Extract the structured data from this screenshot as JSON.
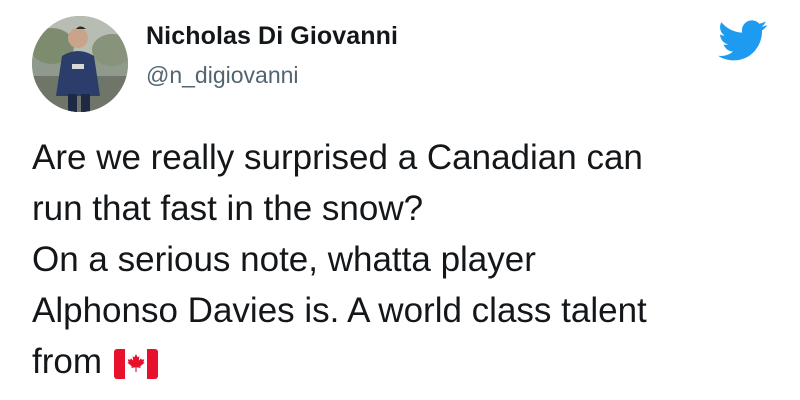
{
  "tweet": {
    "author_name": "Nicholas Di Giovanni",
    "author_handle": "@n_digiovanni",
    "lines": [
      "Are we really surprised a Canadian can",
      "run that fast in the snow?",
      "On a serious note, whatta player",
      "Alphonso Davies is. A world class talent",
      "from"
    ],
    "flag_emoji": "canada-flag-icon",
    "brand_icon": "twitter-bird-icon",
    "colors": {
      "twitter_blue": "#1d9bf0",
      "flag_red": "#e8112d",
      "text": "#14171a",
      "handle": "#536471"
    }
  }
}
